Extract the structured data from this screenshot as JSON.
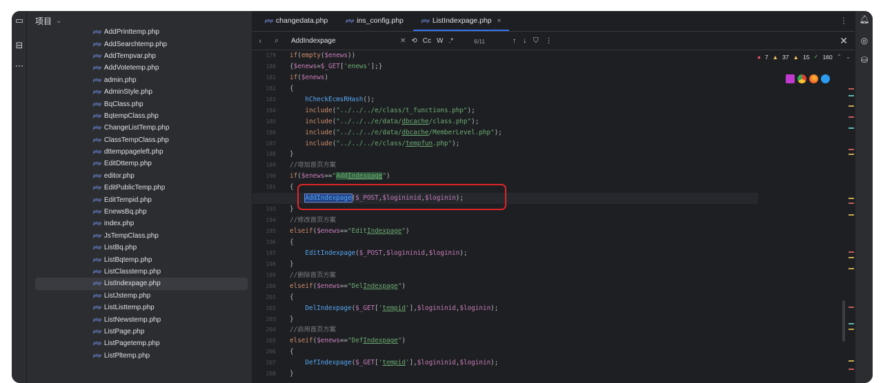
{
  "project_panel": {
    "title": "项目",
    "files": [
      "AddPrinttemp.php",
      "AddSearchtemp.php",
      "AddTempvar.php",
      "AddVotetemp.php",
      "admin.php",
      "AdminStyle.php",
      "BqClass.php",
      "BqtempClass.php",
      "ChangeListTemp.php",
      "ClassTempClass.php",
      "dttemppageleft.php",
      "EditDttemp.php",
      "editor.php",
      "EditPublicTemp.php",
      "EditTempid.php",
      "EnewsBq.php",
      "index.php",
      "JsTempClass.php",
      "ListBq.php",
      "ListBqtemp.php",
      "ListClasstemp.php",
      "ListIndexpage.php",
      "ListJstemp.php",
      "ListListtemp.php",
      "ListNewstemp.php",
      "ListPage.php",
      "ListPagetemp.php",
      "ListPltemp.php"
    ],
    "selected_file": "ListIndexpage.php",
    "file_badge": "php"
  },
  "tabs": [
    {
      "label": "changedata.php",
      "active": false
    },
    {
      "label": "ins_config.php",
      "active": false
    },
    {
      "label": "ListIndexpage.php",
      "active": true
    }
  ],
  "find": {
    "query": "AddIndexpage",
    "case_label": "Cc",
    "word_label": "W",
    "regex_label": ".*",
    "count": "6/11"
  },
  "inspections": {
    "errors": "7",
    "warnings": "37",
    "weak_warnings": "15",
    "ok": "160"
  },
  "gutter": [
    "179",
    "180",
    "181",
    "182",
    "183",
    "184",
    "185",
    "186",
    "187",
    "188",
    "189",
    "190",
    "191",
    "192",
    "193",
    "194",
    "195",
    "196",
    "197",
    "198",
    "199",
    "200",
    "201",
    "202",
    "203",
    "204",
    "205",
    "206",
    "207",
    "208"
  ],
  "current_line": "192",
  "colors": {
    "keyword": "#cf8e6d",
    "variable": "#c77dbb",
    "string": "#6aab73",
    "function": "#56a8f5",
    "comment": "#7a7e85",
    "highlight_box": "#e0252a"
  }
}
